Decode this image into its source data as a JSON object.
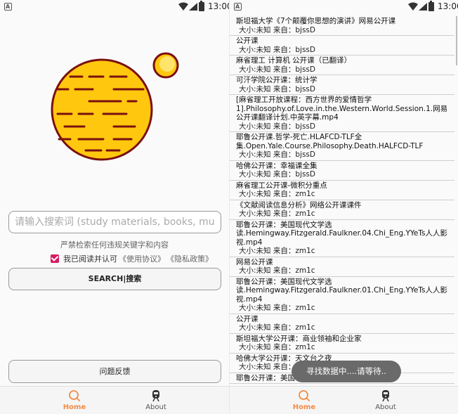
{
  "status_bar": {
    "time": "13:00"
  },
  "home": {
    "search_placeholder": "请输入搜索词 (study materials, books, music, ...)",
    "warning": "严禁检索任何违规关键字和内容",
    "agree_text": "我已阅读并认可",
    "terms_link": "《使用协议》",
    "privacy_link": "《隐私政策》",
    "search_button": "SEARCH|搜索",
    "feedback_button": "问题反馈"
  },
  "nav": {
    "home": "Home",
    "about": "About"
  },
  "colors": {
    "planet": "#ffc80e",
    "planet_stroke": "#7a1010",
    "accent": "#f28c45",
    "checkbox": "#d81b60"
  },
  "results": [
    {
      "title": "斯坦福大学《7个颠覆你思想的演讲》网易公开课",
      "meta": "大小:未知   来自：bjssD"
    },
    {
      "title": "公开课",
      "meta": "大小:未知   来自：bjssD"
    },
    {
      "title": "麻省理工  计算机 公开课（已翻译）",
      "meta": "大小:未知   来自：bjssD"
    },
    {
      "title": "可汗学院公开课：统计学",
      "meta": "大小:未知   来自：bjssD"
    },
    {
      "title": "[麻省理工开放课程：西方世界的爱情哲学1].Philosophy.of.Love.in.the.Western.World.Session.1.网易公开课翻译计划.中英字幕.mp4",
      "meta": "大小:未知   来自：bjssD"
    },
    {
      "title": "耶鲁公开课.哲学-死亡.HLAFCD-TLF全集.Open.Yale.Course.Philosophy.Death.HALFCD-TLF",
      "meta": "大小:未知   来自：bjssD"
    },
    {
      "title": "哈佛公开课：幸福课全集",
      "meta": "大小:未知   来自：bjssD"
    },
    {
      "title": "麻省理工公开课-微积分重点",
      "meta": "大小:未知   来自：zm1c"
    },
    {
      "title": "《文献阅读信息分析》网络公开课课件",
      "meta": "大小:未知   来自：zm1c"
    },
    {
      "title": "耶鲁公开课：美国现代文学选读.Hemingway.Fitzgerald.Faulkner.04.Chi_Eng.YYeTs人人影视.mp4",
      "meta": "大小:未知   来自：zm1c"
    },
    {
      "title": "网易公开课",
      "meta": "大小:未知   来自：zm1c"
    },
    {
      "title": "耶鲁公开课：美国现代文学选读.Hemingway.Fitzgerald.Faulkner.01.Chi_Eng.YYeTs人人影视.mp4",
      "meta": "大小:未知   来自：zm1c"
    },
    {
      "title": "公开课",
      "meta": "大小:未知   来自：zm1c"
    },
    {
      "title": "斯坦福大学公开课：商业领袖和企业家",
      "meta": "大小:未知   来自：zm1c"
    },
    {
      "title": "哈佛大学公开课：天文台之夜",
      "meta": "大小:未知   来自：zm1c"
    },
    {
      "title": "耶鲁公开课：美国",
      "meta": ""
    }
  ],
  "toast": "寻找数据中....请等待.."
}
